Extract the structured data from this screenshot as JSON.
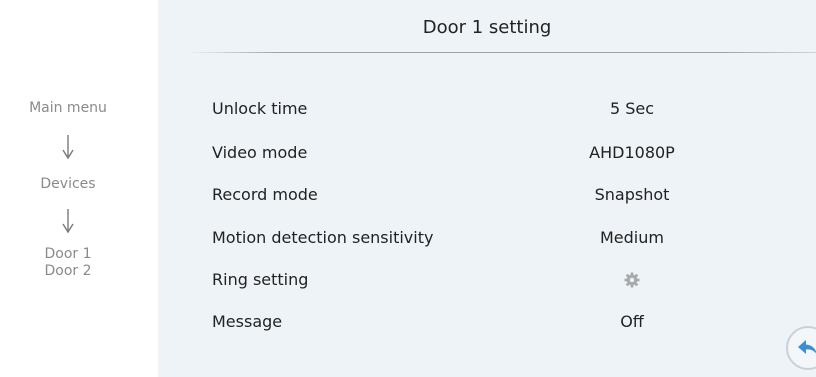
{
  "breadcrumb": {
    "main_menu": "Main menu",
    "devices": "Devices",
    "door_1": "Door 1",
    "door_2": "Door 2"
  },
  "panel": {
    "title": "Door 1 setting"
  },
  "settings": [
    {
      "label": "Unlock time",
      "value": "5 Sec"
    },
    {
      "label": "Video mode",
      "value": "AHD1080P"
    },
    {
      "label": "Record mode",
      "value": "Snapshot"
    },
    {
      "label": "Motion detection sensitivity",
      "value": "Medium"
    },
    {
      "label": "Ring setting",
      "value_icon": "gear-icon"
    },
    {
      "label": "Message",
      "value": "Off"
    }
  ],
  "icons": {
    "back": "back-arrow-icon",
    "ring_setting": "gear-icon",
    "down_arrow": "arrow-down-icon"
  },
  "colors": {
    "panel_background": "#eef3f7",
    "text": "#222222",
    "breadcrumb_text": "#8a8a8a",
    "accent": "#3d8fd1"
  }
}
